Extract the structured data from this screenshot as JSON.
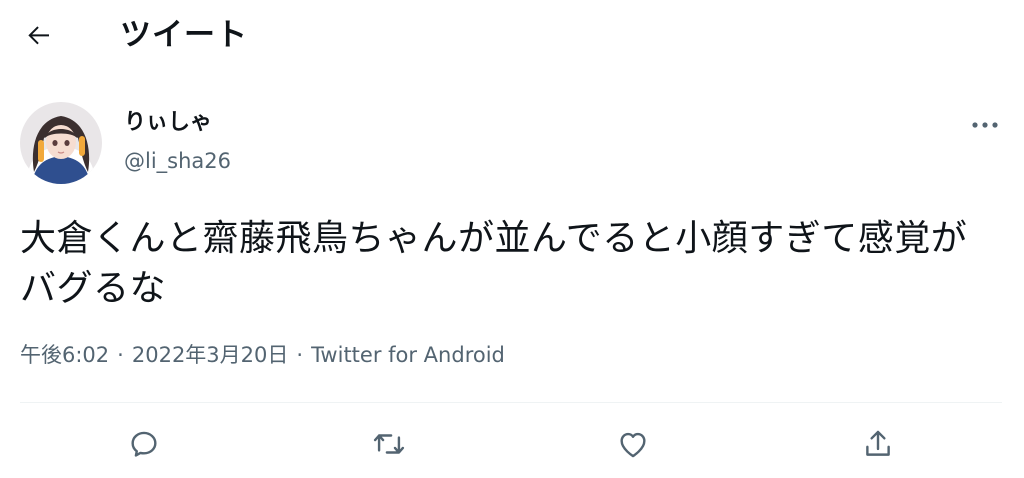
{
  "header": {
    "title": "ツイート"
  },
  "tweet": {
    "display_name": "りぃしゃ",
    "handle": "@li_sha26",
    "text": "大倉くんと齋藤飛鳥ちゃんが並んでると小顔すぎて感覚がバグるな",
    "time": "午後6:02",
    "date": "2022年3月20日",
    "separator": "·",
    "source": "Twitter for Android"
  },
  "icons": {
    "back": "arrow-left-icon",
    "more": "more-horizontal-icon",
    "reply": "reply-icon",
    "retweet": "retweet-icon",
    "like": "heart-icon",
    "share": "share-icon"
  },
  "colors": {
    "text_primary": "#0f1419",
    "text_secondary": "#536471",
    "divider": "#eff3f4"
  }
}
